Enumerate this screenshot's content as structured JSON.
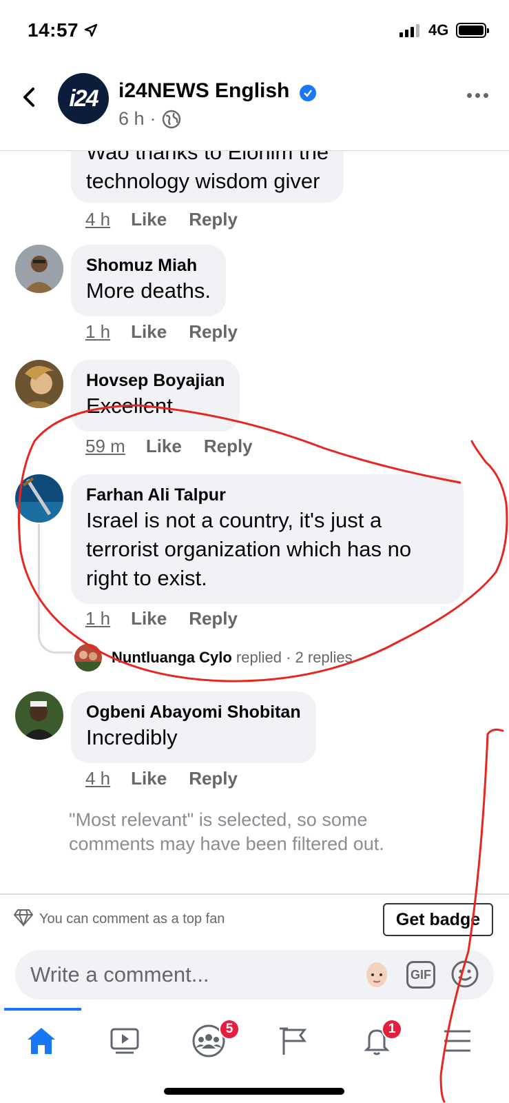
{
  "status_bar": {
    "time": "14:57",
    "network": "4G"
  },
  "header": {
    "page_name": "i24NEWS English",
    "avatar_text": "i24",
    "post_age": "6 h",
    "dot": "·"
  },
  "comments": [
    {
      "author": "",
      "text_line1": "Wao thanks to Elohim the",
      "text_line2": "technology wisdom giver",
      "time": "4 h",
      "like": "Like",
      "reply": "Reply"
    },
    {
      "author": "Shomuz Miah",
      "text": "More deaths.",
      "time": "1 h",
      "like": "Like",
      "reply": "Reply"
    },
    {
      "author": "Hovsep Boyajian",
      "text": "Excellent",
      "time": "59 m",
      "like": "Like",
      "reply": "Reply"
    },
    {
      "author": "Farhan Ali Talpur",
      "text_line1": "Israel is not a country, it's just a",
      "text_line2": "terrorist organization which has no",
      "text_line3": "right to exist.",
      "time": "1 h",
      "like": "Like",
      "reply": "Reply",
      "replies": {
        "name": "Nuntluanga Cylo",
        "verb": "replied",
        "count": "· 2 replies"
      }
    },
    {
      "author": "Ogbeni Abayomi Shobitan",
      "text": "Incredibly",
      "time": "4 h",
      "like": "Like",
      "reply": "Reply"
    }
  ],
  "filter_note": "\"Most relevant\" is selected, so some comments may have been filtered out.",
  "top_fan": {
    "text": "You can comment as a top fan",
    "button": "Get badge"
  },
  "composer": {
    "placeholder": "Write a comment...",
    "gif": "GIF"
  },
  "bottom_nav": {
    "items": [
      {
        "icon": "home-icon",
        "active": true
      },
      {
        "icon": "watch-icon"
      },
      {
        "icon": "groups-icon",
        "badge": "5"
      },
      {
        "icon": "pages-flag-icon"
      },
      {
        "icon": "notifications-bell-icon",
        "badge": "1"
      },
      {
        "icon": "menu-icon"
      }
    ]
  },
  "colors": {
    "accent": "#1877f2",
    "badge": "#e41e3f",
    "bubble": "#f0f2f5",
    "annotation": "#e8251f"
  }
}
